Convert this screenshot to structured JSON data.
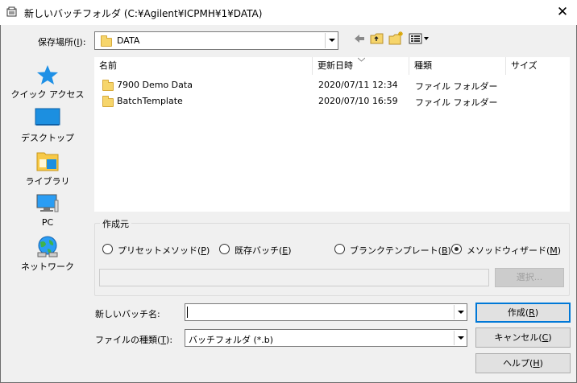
{
  "window": {
    "title": "新しいバッチフォルダ (C:¥Agilent¥ICPMH¥1¥DATA)"
  },
  "location": {
    "label": "保存場所(I):",
    "value": "DATA"
  },
  "places": [
    {
      "label": "クイック アクセス",
      "icon": "quick-access-star-icon"
    },
    {
      "label": "デスクトップ",
      "icon": "desktop-icon"
    },
    {
      "label": "ライブラリ",
      "icon": "library-icon"
    },
    {
      "label": "PC",
      "icon": "pc-icon"
    },
    {
      "label": "ネットワーク",
      "icon": "network-icon"
    }
  ],
  "files": {
    "columns": [
      "名前",
      "更新日時",
      "種類",
      "サイズ"
    ],
    "rows": [
      {
        "name": "7900 Demo Data",
        "modified": "2020/07/11 12:34",
        "type": "ファイル フォルダー",
        "size": ""
      },
      {
        "name": "BatchTemplate",
        "modified": "2020/07/10 16:59",
        "type": "ファイル フォルダー",
        "size": ""
      }
    ]
  },
  "source": {
    "title": "作成元",
    "options": [
      {
        "label": "プリセットメソッド(P)",
        "checked": false
      },
      {
        "label": "既存バッチ(E)",
        "checked": false
      },
      {
        "label": "ブランクテンプレート(B)",
        "checked": false
      },
      {
        "label": "メソッドウィザード(M)",
        "checked": true
      }
    ],
    "browse_label": "選択...",
    "path_value": ""
  },
  "form": {
    "name_label": "新しいバッチ名:",
    "name_value": "",
    "type_label": "ファイルの種類(T):",
    "type_value": "バッチフォルダ (*.b)"
  },
  "buttons": {
    "create": "作成(R)",
    "cancel": "キャンセル(C)",
    "help": "ヘルプ(H)"
  }
}
